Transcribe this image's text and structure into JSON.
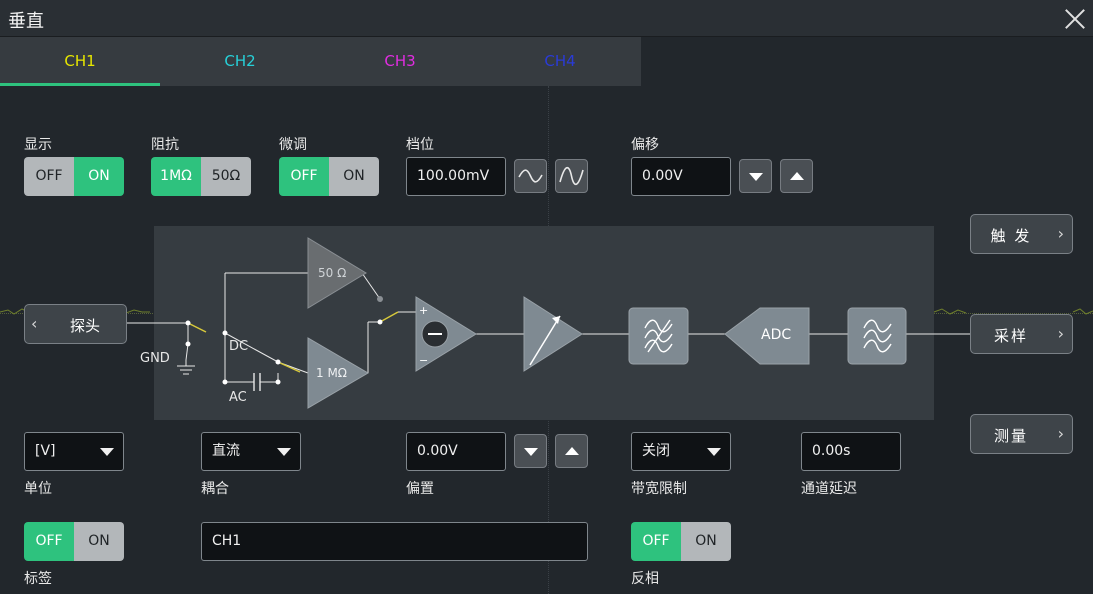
{
  "header": {
    "title": "垂直"
  },
  "tabs": [
    {
      "label": "CH1",
      "color": "#e6e600"
    },
    {
      "label": "CH2",
      "color": "#27d0d8"
    },
    {
      "label": "CH3",
      "color": "#e02de0"
    },
    {
      "label": "CH4",
      "color": "#2a3bd6"
    }
  ],
  "display": {
    "label": "显示",
    "off": "OFF",
    "on": "ON",
    "value": "ON"
  },
  "impedance": {
    "label": "阻抗",
    "opt1": "1MΩ",
    "opt2": "50Ω",
    "value": "1MΩ"
  },
  "fine": {
    "label": "微调",
    "off": "OFF",
    "on": "ON",
    "value": "OFF"
  },
  "scale": {
    "label": "档位",
    "value": "100.00mV"
  },
  "offset": {
    "label": "偏移",
    "value": "0.00V"
  },
  "diagram": {
    "r50": "50 Ω",
    "r1m": "1 MΩ",
    "dc": "DC",
    "ac": "AC",
    "gnd": "GND",
    "adc": "ADC",
    "plus": "+",
    "minus": "−"
  },
  "probe": {
    "label": "探头"
  },
  "side": {
    "trigger": "触 发",
    "acquire": "采样",
    "measure": "测量"
  },
  "unit": {
    "label": "单位",
    "value": "[V]"
  },
  "coupling": {
    "label": "耦合",
    "value": "直流"
  },
  "bias": {
    "label": "偏置",
    "value": "0.00V"
  },
  "bandwidth": {
    "label": "带宽限制",
    "value": "关闭"
  },
  "delay": {
    "label": "通道延迟",
    "value": "0.00s"
  },
  "tag": {
    "label": "标签",
    "off": "OFF",
    "on": "ON",
    "value": "OFF",
    "text": "CH1"
  },
  "invert": {
    "label": "反相",
    "off": "OFF",
    "on": "ON",
    "value": "OFF"
  }
}
